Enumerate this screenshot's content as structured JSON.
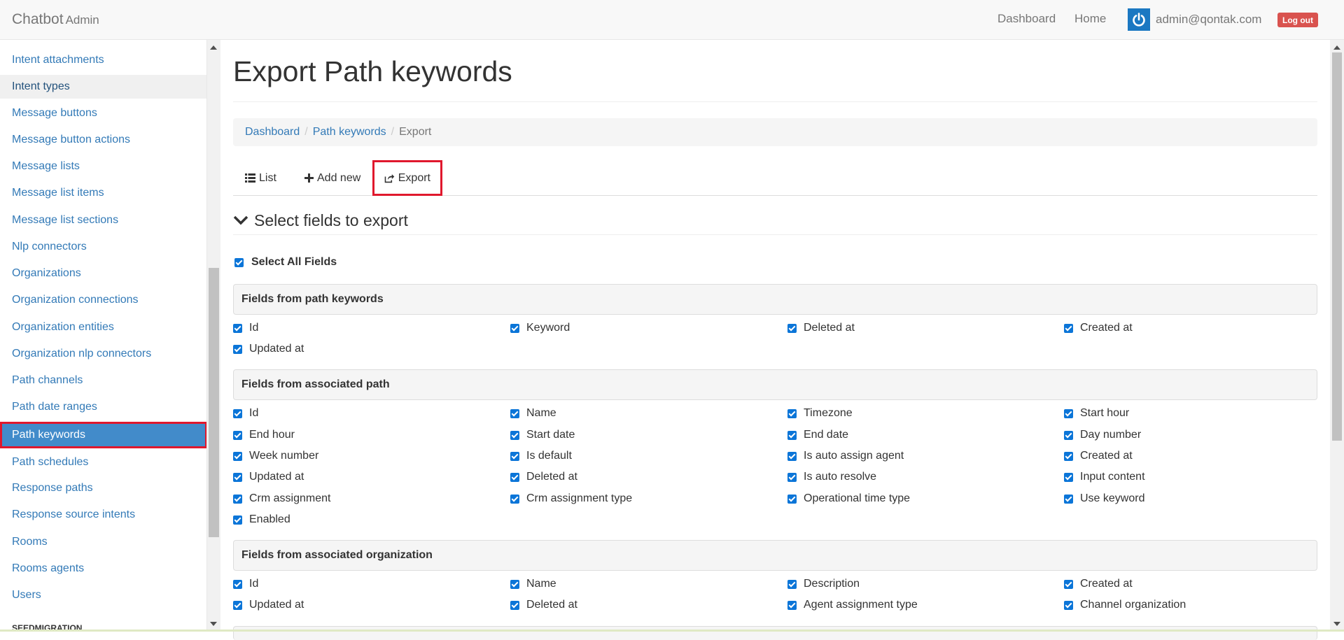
{
  "navbar": {
    "brand": "Chatbot",
    "brand_sub": "Admin",
    "links": [
      "Dashboard",
      "Home"
    ],
    "user_email": "admin@qontak.com",
    "logout": "Log out"
  },
  "sidebar": {
    "items": [
      "Intent attachments",
      "Intent types",
      "Message buttons",
      "Message button actions",
      "Message lists",
      "Message list items",
      "Message list sections",
      "Nlp connectors",
      "Organizations",
      "Organization connections",
      "Organization entities",
      "Organization nlp connectors",
      "Path channels",
      "Path date ranges",
      "Path keywords",
      "Path schedules",
      "Response paths",
      "Response source intents",
      "Rooms",
      "Rooms agents",
      "Users"
    ],
    "active_item": "Path keywords",
    "heading_below": "SEEDMIGRATION"
  },
  "page": {
    "title": "Export Path keywords",
    "breadcrumb": [
      "Dashboard",
      "Path keywords",
      "Export"
    ],
    "tabs": [
      "List",
      "Add new",
      "Export"
    ],
    "active_tab": "Export",
    "section_title": "Select fields to export",
    "select_all": "Select All Fields"
  },
  "groups": [
    {
      "title": "Fields from path keywords",
      "fields": [
        "Id",
        "Keyword",
        "Deleted at",
        "Created at",
        "Updated at"
      ]
    },
    {
      "title": "Fields from associated path",
      "fields": [
        "Id",
        "Name",
        "Timezone",
        "Start hour",
        "End hour",
        "Start date",
        "End date",
        "Day number",
        "Week number",
        "Is default",
        "Is auto assign agent",
        "Created at",
        "Updated at",
        "Deleted at",
        "Is auto resolve",
        "Input content",
        "Crm assignment",
        "Crm assignment type",
        "Operational time type",
        "Use keyword",
        "Enabled"
      ]
    },
    {
      "title": "Fields from associated organization",
      "fields": [
        "Id",
        "Name",
        "Description",
        "Created at",
        "Updated at",
        "Deleted at",
        "Agent assignment type",
        "Channel organization"
      ]
    }
  ],
  "colors": {
    "accent": "#337ab7",
    "active_bg": "#428bca",
    "highlight_border": "#e0182d",
    "logout": "#d9534f",
    "checkbox": "#0b75d8"
  }
}
